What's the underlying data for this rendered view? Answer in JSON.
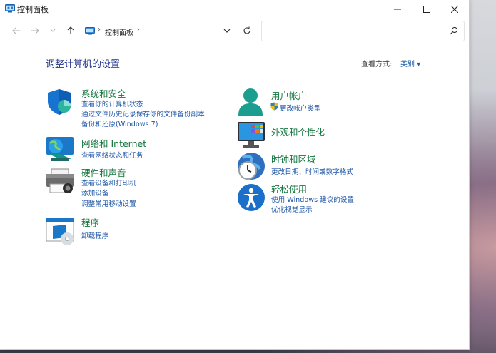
{
  "window": {
    "title": "控制面板"
  },
  "nav": {
    "breadcrumb": "控制面板"
  },
  "content": {
    "heading": "调整计算机的设置",
    "view_by_label": "查看方式:",
    "view_by_value": "类别 ▾"
  },
  "categories": {
    "system_security": {
      "title": "系统和安全",
      "links": [
        "查看你的计算机状态",
        "通过文件历史记录保存你的文件备份副本",
        "备份和还原(Windows 7)"
      ]
    },
    "network": {
      "title": "网络和 Internet",
      "links": [
        "查看网络状态和任务"
      ]
    },
    "hardware": {
      "title": "硬件和声音",
      "links": [
        "查看设备和打印机",
        "添加设备",
        "调整常用移动设置"
      ]
    },
    "programs": {
      "title": "程序",
      "links": [
        "卸载程序"
      ]
    },
    "user_accounts": {
      "title": "用户帐户",
      "links": [
        "更改帐户类型"
      ]
    },
    "appearance": {
      "title": "外观和个性化",
      "links": []
    },
    "clock_region": {
      "title": "时钟和区域",
      "links": [
        "更改日期、时间或数字格式"
      ]
    },
    "ease_of_access": {
      "title": "轻松使用",
      "links": [
        "使用 Windows 建议的设置",
        "优化视觉显示"
      ]
    }
  },
  "colors": {
    "category_title": "#13753d",
    "link": "#1d55a5",
    "heading": "#1e3287"
  }
}
